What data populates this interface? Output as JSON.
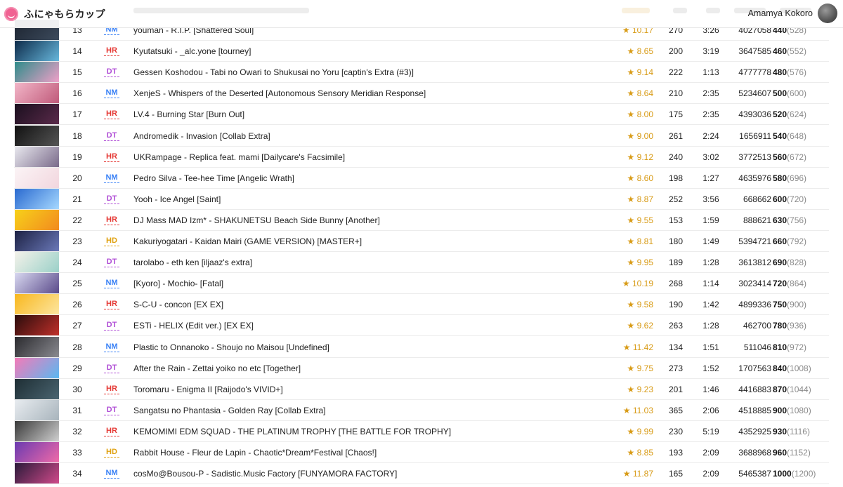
{
  "app": {
    "brand_name": "ふにゃもらカップ",
    "user_name": "Amamya Kokoro"
  },
  "colors": {
    "NM": "#3b82f6",
    "HR": "#e53935",
    "DT": "#b04fd6",
    "HD": "#e0a10f",
    "star": "#d89b16"
  },
  "rows": [
    {
      "rank": "13",
      "mod": "NM",
      "title": "youman - R.I.P. [Shattered Soul]",
      "star": "★ 10.17",
      "combo": "270",
      "length": "3:26",
      "score": "4027058",
      "points": "440",
      "weighted": "(528)",
      "thumb": [
        "#1c2430",
        "#3c4a5c"
      ]
    },
    {
      "rank": "14",
      "mod": "HR",
      "title": "Kyutatsuki - _alc.yone [tourney]",
      "star": "★ 8.65",
      "combo": "200",
      "length": "3:19",
      "score": "3647585",
      "points": "460",
      "weighted": "(552)",
      "thumb": [
        "#0d2b4a",
        "#67b7dc"
      ]
    },
    {
      "rank": "15",
      "mod": "DT",
      "title": "Gessen Koshodou - Tabi no Owari to Shukusai no Yoru [captin's Extra (#3)]",
      "star": "★ 9.14",
      "combo": "222",
      "length": "1:13",
      "score": "4777778",
      "points": "480",
      "weighted": "(576)",
      "thumb": [
        "#2e8c8a",
        "#f0a0c8"
      ]
    },
    {
      "rank": "16",
      "mod": "NM",
      "title": "XenjeS - Whispers of the Deserted [Autonomous Sensory Meridian Response]",
      "star": "★ 8.64",
      "combo": "210",
      "length": "2:35",
      "score": "5234607",
      "points": "500",
      "weighted": "(600)",
      "thumb": [
        "#f2b6c8",
        "#c05a7a"
      ]
    },
    {
      "rank": "17",
      "mod": "HR",
      "title": "LV.4 - Burning Star [Burn Out]",
      "star": "★ 8.00",
      "combo": "175",
      "length": "2:35",
      "score": "4393036",
      "points": "520",
      "weighted": "(624)",
      "thumb": [
        "#1a0f1e",
        "#5a2a4a"
      ]
    },
    {
      "rank": "18",
      "mod": "DT",
      "title": "Andromedik - Invasion [Collab Extra]",
      "star": "★ 9.00",
      "combo": "261",
      "length": "2:24",
      "score": "1656911",
      "points": "540",
      "weighted": "(648)",
      "thumb": [
        "#111111",
        "#555555"
      ]
    },
    {
      "rank": "19",
      "mod": "HR",
      "title": "UKRampage - Replica feat. mami [Dailycare's Facsimile]",
      "star": "★ 9.12",
      "combo": "240",
      "length": "3:02",
      "score": "3772513",
      "points": "560",
      "weighted": "(672)",
      "thumb": [
        "#e8e8ee",
        "#7a6a8a"
      ]
    },
    {
      "rank": "20",
      "mod": "NM",
      "title": "Pedro Silva - Tee-hee Time [Angelic Wrath]",
      "star": "★ 8.60",
      "combo": "198",
      "length": "1:27",
      "score": "4635976",
      "points": "580",
      "weighted": "(696)",
      "thumb": [
        "#fbf4f6",
        "#f2d6de"
      ]
    },
    {
      "rank": "21",
      "mod": "DT",
      "title": "Yooh - Ice Angel [Saint]",
      "star": "★ 8.87",
      "combo": "252",
      "length": "3:56",
      "score": "668662",
      "points": "600",
      "weighted": "(720)",
      "thumb": [
        "#2a6ad0",
        "#a6d8ff"
      ]
    },
    {
      "rank": "22",
      "mod": "HR",
      "title": "DJ Mass MAD Izm* - SHAKUNETSU Beach Side Bunny [Another]",
      "star": "★ 9.55",
      "combo": "153",
      "length": "1:59",
      "score": "888621",
      "points": "630",
      "weighted": "(756)",
      "thumb": [
        "#f7d11a",
        "#f28a1e"
      ]
    },
    {
      "rank": "23",
      "mod": "HD",
      "title": "Kakuriyogatari - Kaidan Mairi (GAME VERSION) [MASTER+]",
      "star": "★ 8.81",
      "combo": "180",
      "length": "1:49",
      "score": "5394721",
      "points": "660",
      "weighted": "(792)",
      "thumb": [
        "#1d2244",
        "#6a78b8"
      ]
    },
    {
      "rank": "24",
      "mod": "DT",
      "title": "tarolabo - eth ken [iljaaz's extra]",
      "star": "★ 9.95",
      "combo": "189",
      "length": "1:28",
      "score": "3613812",
      "points": "690",
      "weighted": "(828)",
      "thumb": [
        "#f4f2ea",
        "#9ad0c8"
      ]
    },
    {
      "rank": "25",
      "mod": "NM",
      "title": "[Kyoro] - Mochio- [Fatal]",
      "star": "★ 10.19",
      "combo": "268",
      "length": "1:14",
      "score": "3023414",
      "points": "720",
      "weighted": "(864)",
      "thumb": [
        "#d8d8f0",
        "#5a4a8a"
      ]
    },
    {
      "rank": "26",
      "mod": "HR",
      "title": "S-C-U - concon [EX EX]",
      "star": "★ 9.58",
      "combo": "190",
      "length": "1:42",
      "score": "4899336",
      "points": "750",
      "weighted": "(900)",
      "thumb": [
        "#f8b71e",
        "#fde6a0"
      ]
    },
    {
      "rank": "27",
      "mod": "DT",
      "title": "ESTi - HELIX (Edit ver.) [EX EX]",
      "star": "★ 9.62",
      "combo": "263",
      "length": "1:28",
      "score": "462700",
      "points": "780",
      "weighted": "(936)",
      "thumb": [
        "#2a0c0c",
        "#c0302a"
      ]
    },
    {
      "rank": "28",
      "mod": "NM",
      "title": "Plastic to Onnanoko - Shoujo no Maisou [Undefined]",
      "star": "★ 11.42",
      "combo": "134",
      "length": "1:51",
      "score": "511046",
      "points": "810",
      "weighted": "(972)",
      "thumb": [
        "#2a2a2e",
        "#8a8a90"
      ]
    },
    {
      "rank": "29",
      "mod": "DT",
      "title": "After the Rain - Zettai yoiko no etc [Together]",
      "star": "★ 9.75",
      "combo": "273",
      "length": "1:52",
      "score": "1707563",
      "points": "840",
      "weighted": "(1008)",
      "thumb": [
        "#f47ab8",
        "#5ab8f0"
      ]
    },
    {
      "rank": "30",
      "mod": "HR",
      "title": "Toromaru - Enigma II [Raijodo's VIVID+]",
      "star": "★ 9.23",
      "combo": "201",
      "length": "1:46",
      "score": "4416883",
      "points": "870",
      "weighted": "(1044)",
      "thumb": [
        "#1e2e34",
        "#4a6470"
      ]
    },
    {
      "rank": "31",
      "mod": "DT",
      "title": "Sangatsu no Phantasia - Golden Ray [Collab Extra]",
      "star": "★ 11.03",
      "combo": "365",
      "length": "2:06",
      "score": "4518885",
      "points": "900",
      "weighted": "(1080)",
      "thumb": [
        "#e8ecf0",
        "#a8b4bc"
      ]
    },
    {
      "rank": "32",
      "mod": "HR",
      "title": "KEMOMIMI EDM SQUAD - THE PLATINUM TROPHY [THE BATTLE FOR TROPHY]",
      "star": "★ 9.99",
      "combo": "230",
      "length": "5:19",
      "score": "4352925",
      "points": "930",
      "weighted": "(1116)",
      "thumb": [
        "#3a3a3a",
        "#d0d0d0"
      ]
    },
    {
      "rank": "33",
      "mod": "HD",
      "title": "Rabbit House - Fleur de Lapin - Chaotic*Dream*Festival [Chaos!]",
      "star": "★ 8.85",
      "combo": "193",
      "length": "2:09",
      "score": "3688968",
      "points": "960",
      "weighted": "(1152)",
      "thumb": [
        "#6a3ab0",
        "#f06aa8"
      ]
    },
    {
      "rank": "34",
      "mod": "NM",
      "title": "cosMo@Bousou-P - Sadistic.Music Factory [FUNYAMORA FACTORY]",
      "star": "★ 11.87",
      "combo": "165",
      "length": "2:09",
      "score": "5465387",
      "points": "1000",
      "weighted": "(1200)",
      "thumb": [
        "#2a1a3a",
        "#d04a8a"
      ]
    }
  ]
}
